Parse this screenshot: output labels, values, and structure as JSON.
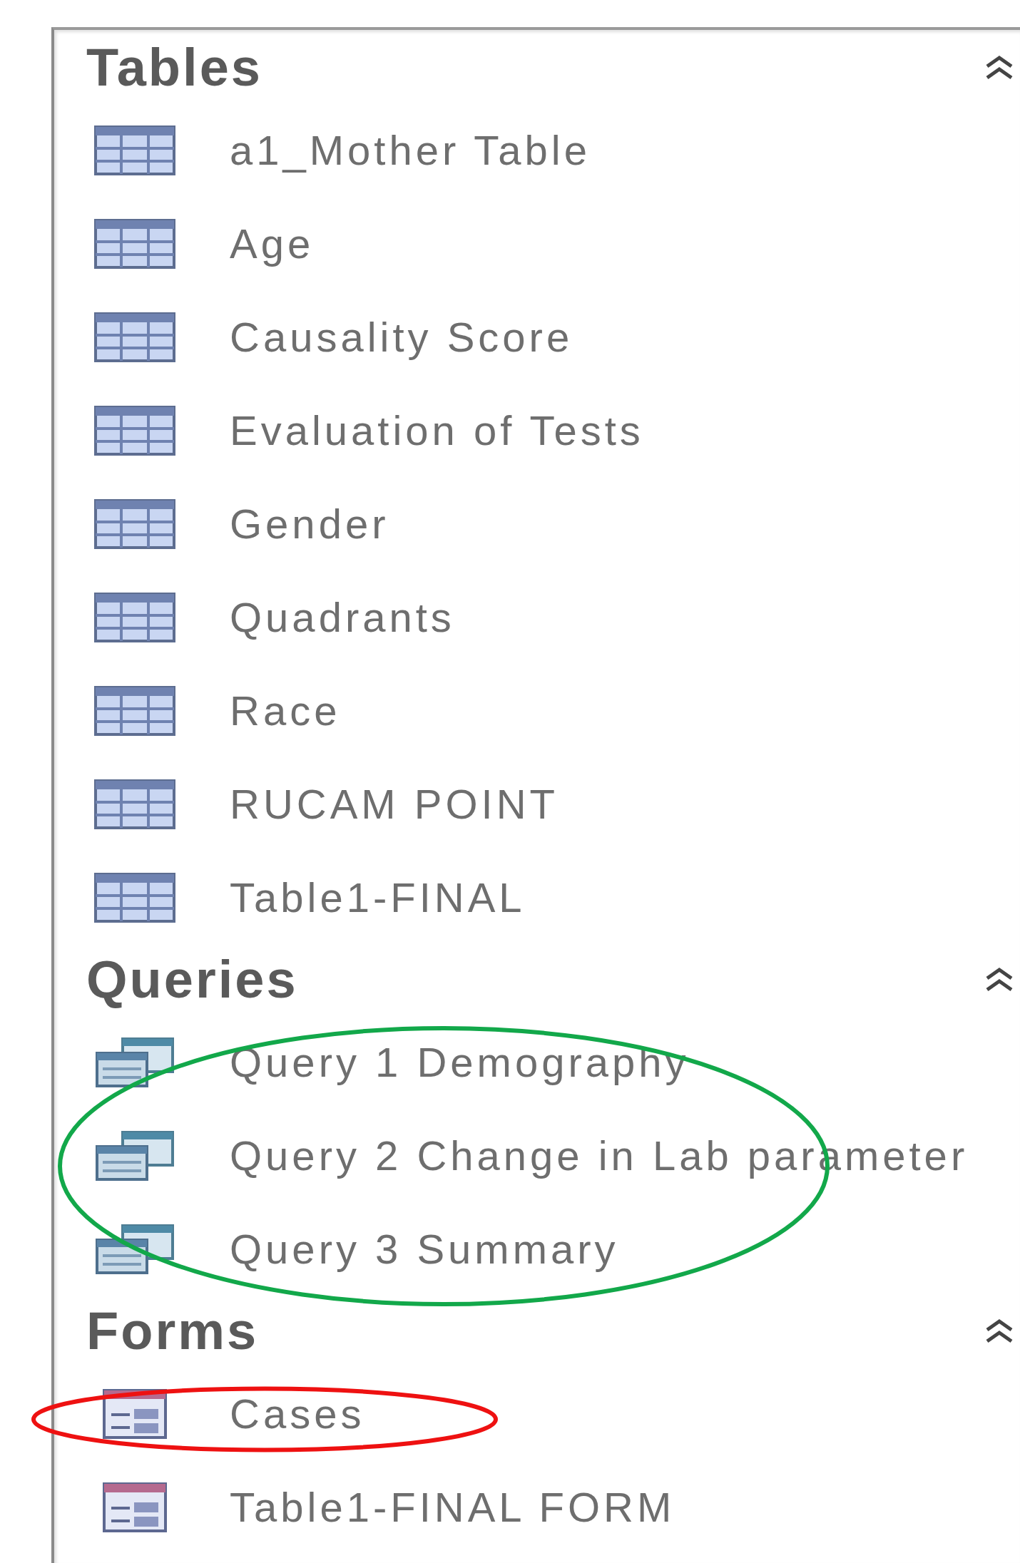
{
  "sections": [
    {
      "title": "Tables",
      "collapsed": false,
      "items": [
        {
          "kind": "table",
          "label": "a1_Mother Table"
        },
        {
          "kind": "table",
          "label": "Age"
        },
        {
          "kind": "table",
          "label": "Causality Score"
        },
        {
          "kind": "table",
          "label": "Evaluation of Tests"
        },
        {
          "kind": "table",
          "label": "Gender"
        },
        {
          "kind": "table",
          "label": "Quadrants"
        },
        {
          "kind": "table",
          "label": "Race"
        },
        {
          "kind": "table",
          "label": "RUCAM POINT"
        },
        {
          "kind": "table",
          "label": "Table1-FINAL"
        }
      ]
    },
    {
      "title": "Queries",
      "collapsed": false,
      "annotation": {
        "kind": "ellipse",
        "color": "#12a84a"
      },
      "items": [
        {
          "kind": "query",
          "label": "Query 1 Demography"
        },
        {
          "kind": "query",
          "label": "Query 2 Change in Lab parameter"
        },
        {
          "kind": "query",
          "label": "Query 3 Summary"
        }
      ]
    },
    {
      "title": "Forms",
      "collapsed": false,
      "items": [
        {
          "kind": "form",
          "label": "Cases",
          "annotation": {
            "kind": "ellipse",
            "color": "#ee1111"
          }
        },
        {
          "kind": "form",
          "label": "Table1-FINAL FORM"
        }
      ]
    }
  ]
}
